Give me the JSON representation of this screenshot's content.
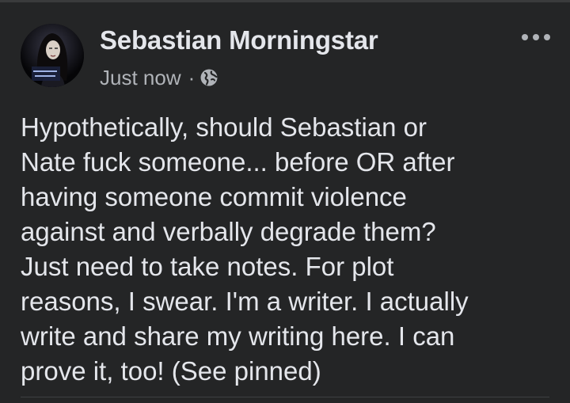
{
  "post": {
    "author": {
      "name": "Sebastian Morningstar",
      "avatar_icon": "profile-photo"
    },
    "timestamp": "Just now",
    "separator": "·",
    "audience_icon": "globe-icon",
    "menu_icon": "more-dots-icon",
    "body_lines": [
      "Hypothetically, should Sebastian or",
      "Nate fuck someone... before OR after",
      "having someone commit violence",
      "against and verbally degrade them?",
      "Just need to take notes. For plot",
      "reasons, I swear. I'm a writer. I actually",
      "write and share my writing here. I can",
      "prove it, too! (See pinned)"
    ]
  },
  "colors": {
    "background": "#242526",
    "primary_text": "#e4e6eb",
    "secondary_text": "#b0b3b8",
    "divider": "#3e4042"
  }
}
